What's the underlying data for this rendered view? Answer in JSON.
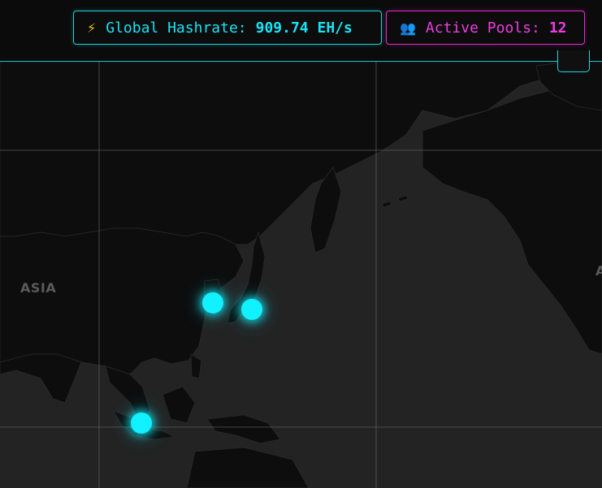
{
  "header": {
    "hashrate": {
      "icon": "lightning-icon",
      "label": "Global Hashrate:",
      "value": "909.74 EH/s",
      "color": "#19e3f2"
    },
    "pools": {
      "icon": "users-icon",
      "label": "Active Pools:",
      "value": "12",
      "color": "#f03ce0"
    }
  },
  "map": {
    "labels": {
      "asia": "ASIA",
      "edge": "A"
    },
    "pool_markers": [
      {
        "name": "pool-marker-korea"
      },
      {
        "name": "pool-marker-japan"
      },
      {
        "name": "pool-marker-java"
      }
    ],
    "marker_color": "#12f1ff",
    "land_color": "#0d0d0d",
    "water_color": "#232323"
  }
}
